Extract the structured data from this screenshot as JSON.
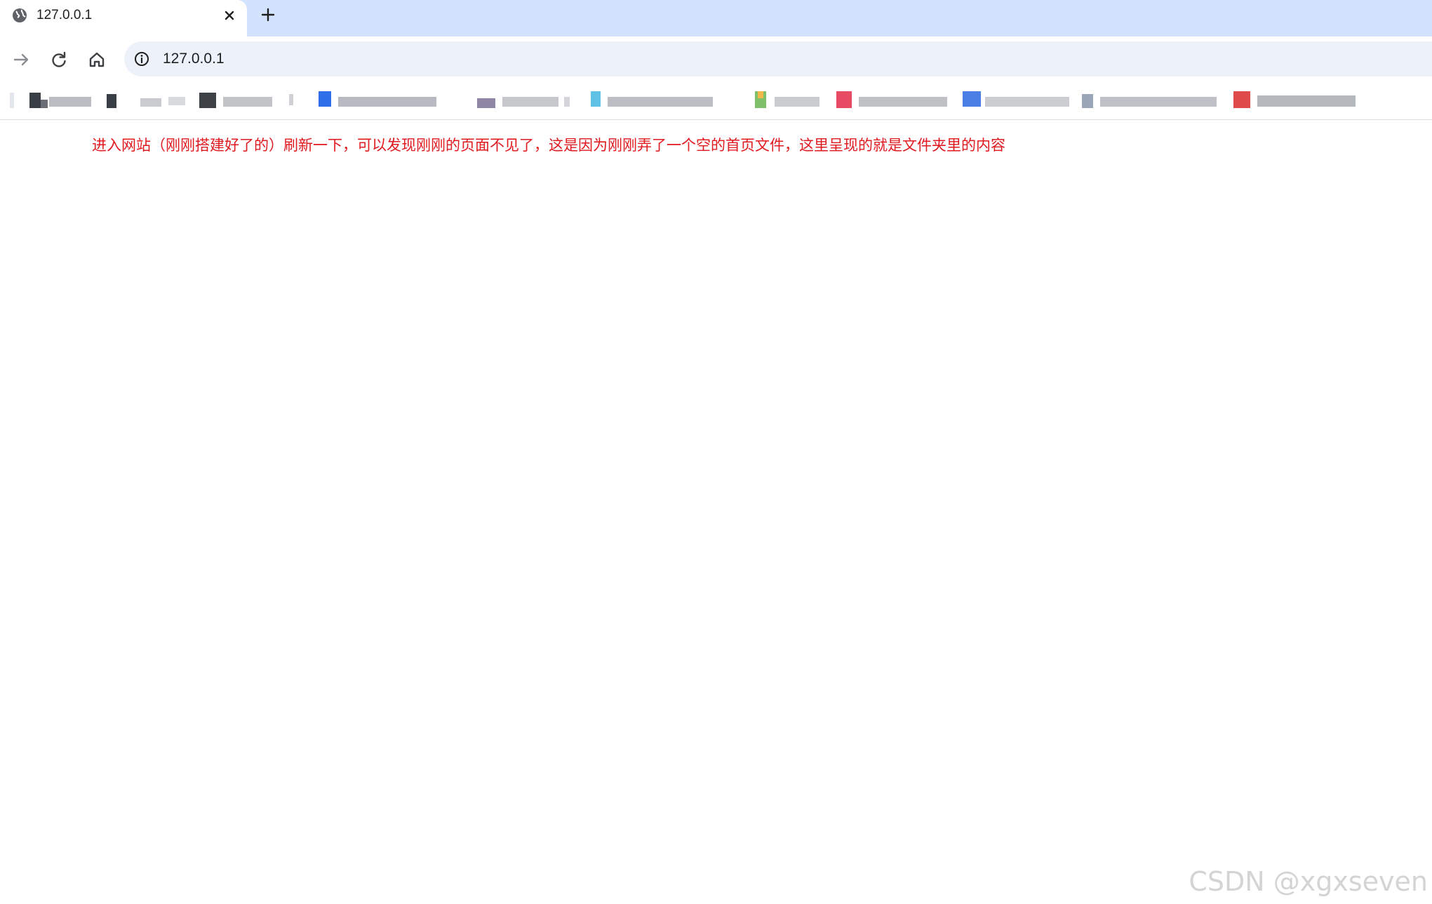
{
  "tabs": [
    {
      "title": "127.0.0.1",
      "icon": "globe-icon",
      "active": true
    }
  ],
  "toolbar": {
    "url": "127.0.0.1"
  },
  "page": {
    "note": "进入网站（刚刚搭建好了的）刷新一下，可以发现刚刚的页面不见了，这是因为刚刚弄了一个空的首页文件，这里呈现的就是文件夹里的内容"
  },
  "watermark": {
    "text": "CSDN @xgxseven"
  },
  "colors": {
    "tabstrip": "#d3e3fd",
    "omnibox": "#edf2fa",
    "annotation": "#e0191f"
  }
}
